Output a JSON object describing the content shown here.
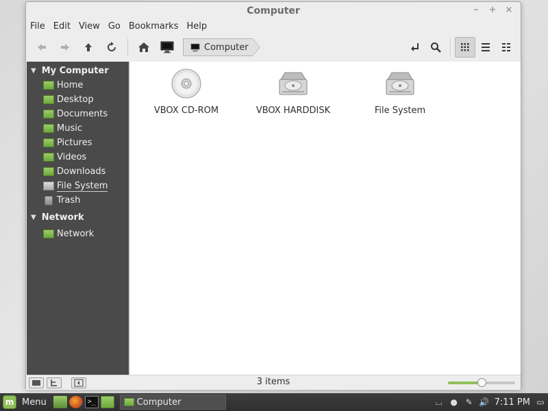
{
  "window": {
    "title": "Computer",
    "controls": {
      "minimize": "–",
      "maximize": "+",
      "close": "×"
    }
  },
  "menubar": [
    "File",
    "Edit",
    "View",
    "Go",
    "Bookmarks",
    "Help"
  ],
  "toolbar": {
    "path_label": "Computer"
  },
  "sidebar": {
    "sections": [
      {
        "title": "My Computer",
        "items": [
          {
            "label": "Home",
            "icon": "home-folder-icon"
          },
          {
            "label": "Desktop",
            "icon": "desktop-folder-icon"
          },
          {
            "label": "Documents",
            "icon": "documents-folder-icon"
          },
          {
            "label": "Music",
            "icon": "music-folder-icon"
          },
          {
            "label": "Pictures",
            "icon": "pictures-folder-icon"
          },
          {
            "label": "Videos",
            "icon": "videos-folder-icon"
          },
          {
            "label": "Downloads",
            "icon": "downloads-folder-icon"
          },
          {
            "label": "File System",
            "icon": "drive-icon"
          },
          {
            "label": "Trash",
            "icon": "trash-icon"
          }
        ]
      },
      {
        "title": "Network",
        "items": [
          {
            "label": "Network",
            "icon": "network-folder-icon"
          }
        ]
      }
    ]
  },
  "main": {
    "items": [
      {
        "label": "VBOX CD-ROM",
        "icon": "cdrom-icon"
      },
      {
        "label": "VBOX HARDDISK",
        "icon": "harddisk-icon"
      },
      {
        "label": "File System",
        "icon": "harddisk-icon"
      }
    ]
  },
  "statusbar": {
    "items_text": "3 items",
    "zoom_level": 0.5
  },
  "taskbar": {
    "menu_label": "Menu",
    "task_label": "Computer",
    "clock": "7:11 PM"
  },
  "colors": {
    "sidebar_bg": "#4a4a4a",
    "accent_green": "#8fbf5a"
  }
}
